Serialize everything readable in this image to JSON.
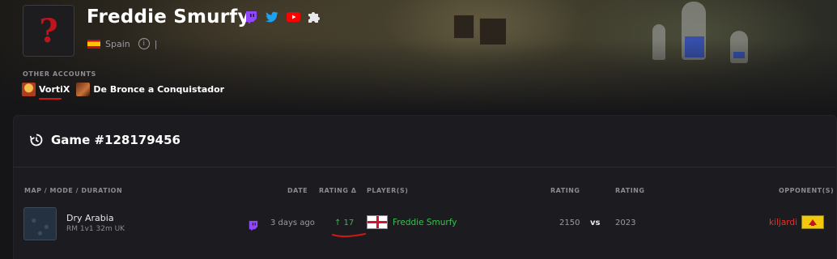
{
  "profile": {
    "name": "Freddie Smurfy",
    "avatar_glyph": "?",
    "country": "Spain",
    "separator": "|",
    "info_glyph": "i",
    "socials": [
      "twitch-icon",
      "twitter-icon",
      "youtube-icon",
      "puzzle-icon"
    ]
  },
  "other_accounts": {
    "title": "OTHER ACCOUNTS",
    "items": [
      {
        "label": "VortiX"
      },
      {
        "label": "De Bronce a Conquistador"
      }
    ]
  },
  "game": {
    "title": "Game #128179456",
    "columns": {
      "map": "MAP / MODE / DURATION",
      "date": "DATE",
      "rating_delta": "RATING Δ",
      "players": "PLAYER(S)",
      "rating1": "RATING",
      "rating2": "RATING",
      "opponents": "OPPONENT(S)"
    },
    "row": {
      "map_name": "Dry Arabia",
      "meta": "RM 1v1  32m  UK",
      "date": "3 days ago",
      "rating_delta": "↑ 17",
      "player": "Freddie Smurfy",
      "rating1": "2150",
      "vs": "vs",
      "rating2": "2023",
      "opponent": "kiljardi"
    }
  },
  "colors": {
    "accent_green": "#39c04e",
    "accent_red": "#e0322e",
    "twitch": "#9146ff",
    "twitter": "#1da1f2",
    "youtube": "#ff0000"
  }
}
